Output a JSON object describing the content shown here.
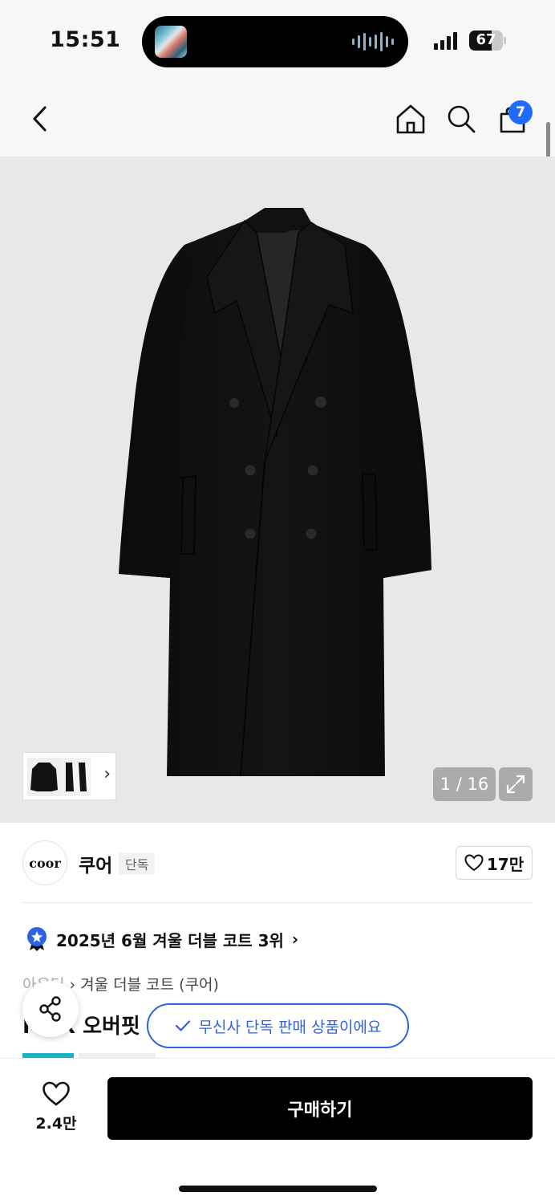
{
  "status": {
    "time": "15:51",
    "battery_level": "67",
    "battery_fraction": 0.67,
    "icons": [
      "now-playing-artwork",
      "audio-waveform-icon",
      "cellular-signal-icon",
      "battery-icon"
    ]
  },
  "nav": {
    "icons": [
      "back-chevron-icon",
      "home-icon",
      "search-icon",
      "shopping-bag-icon"
    ],
    "cart_count": "7"
  },
  "gallery": {
    "counter": "1 / 16",
    "more_glyph": "›",
    "icons": [
      "expand-icon"
    ]
  },
  "brand": {
    "logo_text": "coor",
    "name": "쿠어",
    "tag": "단독",
    "likes": "17만",
    "icons": [
      "heart-outline-icon"
    ]
  },
  "ranking": {
    "text": "2025년 6월 겨울 더블 코트 3위",
    "chevron": "›",
    "icons": [
      "ranking-badge-icon"
    ]
  },
  "breadcrumb": {
    "parent": "아우터",
    "separator": "›",
    "current": "겨울 더블 코트 (쿠어)"
  },
  "product": {
    "title_partial": "MAX 오버핏"
  },
  "exclusive_notice": {
    "text": "무신사 단독 판매 상품이에요",
    "icons": [
      "checkmark-icon"
    ]
  },
  "share": {
    "icons": [
      "share-icon"
    ]
  },
  "bottom": {
    "wish_count": "2.4만",
    "buy_label": "구매하기",
    "icons": [
      "heart-outline-icon"
    ]
  },
  "colors": {
    "accent_blue": "#2e63e0",
    "badge_blue": "#1f6bff",
    "tag_teal": "#19b4c2",
    "buy_button": "#000000"
  }
}
